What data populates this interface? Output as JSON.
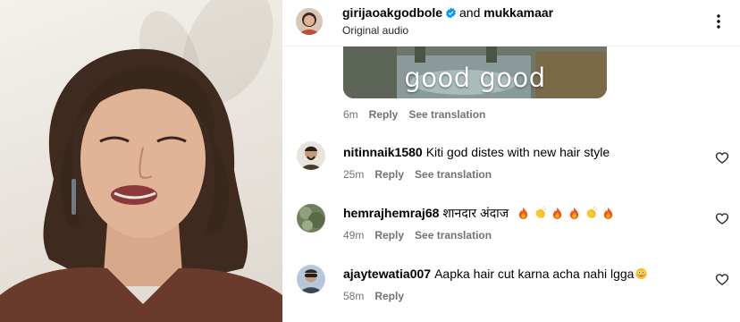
{
  "header": {
    "owner_username": "girijaoakgodbole",
    "and_text": "and",
    "collaborator_username": "mukkamaar",
    "audio_label": "Original audio"
  },
  "gif_reply": {
    "caption": "good good",
    "time": "6m",
    "reply_label": "Reply",
    "translate_label": "See translation"
  },
  "comments": [
    {
      "username": "nitinnaik1580",
      "text": "Kiti god distes with new hair style",
      "time": "25m",
      "reply_label": "Reply",
      "translate_label": "See translation",
      "emoji": []
    },
    {
      "username": "hemrajhemraj68",
      "text": "शानदार अंदाज",
      "time": "49m",
      "reply_label": "Reply",
      "translate_label": "See translation",
      "emoji": [
        "fire",
        "clap",
        "fire",
        "fire",
        "clap",
        "fire"
      ]
    },
    {
      "username": "ajaytewatia007",
      "text": "Aapka hair cut karna acha nahi lgga",
      "time": "58m",
      "reply_label": "Reply",
      "translate_label": "",
      "emoji": [
        "flushed-face"
      ]
    }
  ],
  "icons": [
    "verified-badge-icon",
    "more-options-icon",
    "heart-icon",
    "fire-emoji",
    "clapping-hands-emoji",
    "flushed-face-emoji"
  ],
  "colors": {
    "verified": "#0095f6",
    "meta_text": "#737373",
    "divider": "#efefef"
  }
}
